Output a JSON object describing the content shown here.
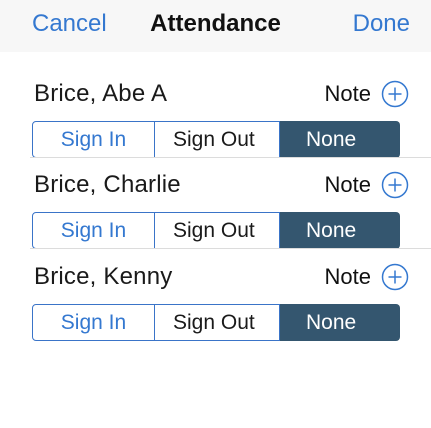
{
  "navbar": {
    "cancel_label": "Cancel",
    "title": "Attendance",
    "done_label": "Done"
  },
  "colors": {
    "accent": "#3478d0",
    "selected_segment": "#34566f",
    "navbar_bg": "#f7f7f7"
  },
  "note_icon": "plus-circle-icon",
  "students": [
    {
      "name": "Brice, Abe A",
      "note_label": "Note",
      "segments": [
        "Sign In",
        "Sign Out",
        "None"
      ],
      "selected": "None"
    },
    {
      "name": "Brice, Charlie",
      "note_label": "Note",
      "segments": [
        "Sign In",
        "Sign Out",
        "None"
      ],
      "selected": "None"
    },
    {
      "name": "Brice, Kenny",
      "note_label": "Note",
      "segments": [
        "Sign In",
        "Sign Out",
        "None"
      ],
      "selected": "None"
    }
  ]
}
